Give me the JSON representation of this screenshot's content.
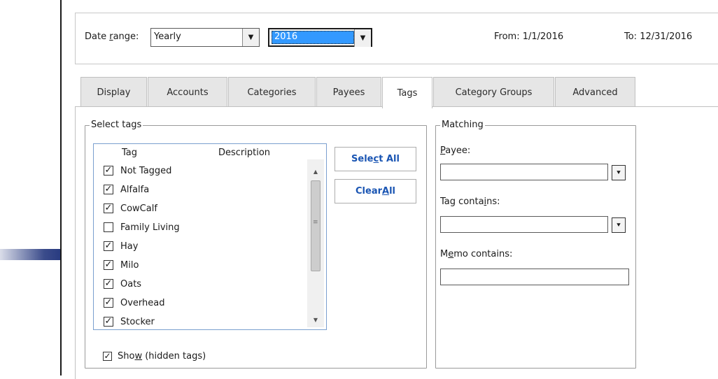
{
  "date_range": {
    "label": "Date range:",
    "period_value": "Yearly",
    "year_value": "2016",
    "from_label": "From:",
    "from_value": "1/1/2016",
    "to_label": "To:",
    "to_value": "12/31/2016"
  },
  "tabs": [
    {
      "label": "Display"
    },
    {
      "label": "Accounts"
    },
    {
      "label": "Categories"
    },
    {
      "label": "Payees"
    },
    {
      "label": "Tags",
      "active": true
    },
    {
      "label": "Category Groups"
    },
    {
      "label": "Advanced"
    }
  ],
  "select_tags": {
    "title": "Select tags",
    "col_tag": "Tag",
    "col_description": "Description",
    "items": [
      {
        "label": "Not Tagged",
        "checked": true
      },
      {
        "label": "Alfalfa",
        "checked": true
      },
      {
        "label": "CowCalf",
        "checked": true
      },
      {
        "label": "Family Living",
        "checked": false
      },
      {
        "label": "Hay",
        "checked": true
      },
      {
        "label": "Milo",
        "checked": true
      },
      {
        "label": "Oats",
        "checked": true
      },
      {
        "label": "Overhead",
        "checked": true
      },
      {
        "label": "Stocker",
        "checked": true
      }
    ],
    "select_all_label": "Select All",
    "clear_all_label": "Clear All",
    "show_hidden_label": "Show (hidden tags)",
    "show_hidden_checked": true
  },
  "matching": {
    "title": "Matching",
    "payee_label": "Payee:",
    "payee_value": "",
    "tag_contains_label": "Tag contains:",
    "tag_contains_value": "",
    "memo_contains_label": "Memo contains:",
    "memo_contains_value": ""
  },
  "colors": {
    "selection": "#3399ff",
    "link_blue": "#1a55b3",
    "arrow": "#0a1f6e"
  },
  "icons": {
    "pointer_arrow": "arrow-right-icon"
  }
}
